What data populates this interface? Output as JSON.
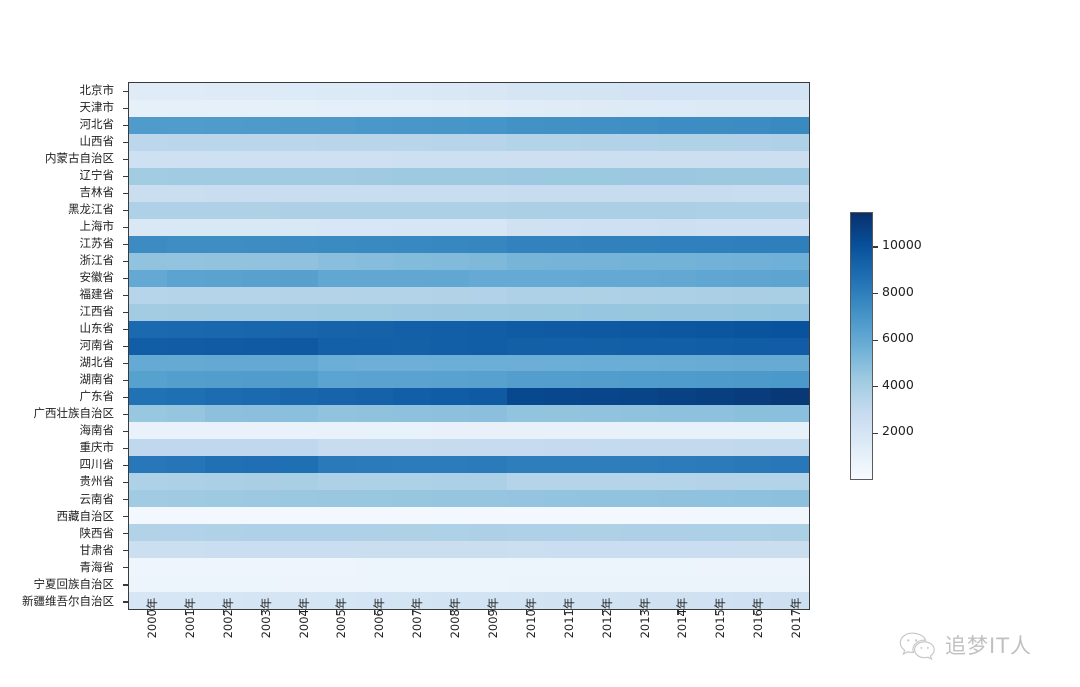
{
  "figure": {
    "type": "heatmap",
    "background": "#ffffff",
    "colormap": "Blues"
  },
  "watermark": {
    "label": "追梦IT人",
    "icon": "wechat-logo-icon"
  },
  "colorbar": {
    "position": "right",
    "vmin": 0,
    "vmax": 11500,
    "ticks": [
      2000,
      4000,
      6000,
      8000,
      10000
    ],
    "tick_labels": [
      "2000",
      "4000",
      "6000",
      "8000",
      "10000"
    ],
    "low_color": "#f7fbff",
    "high_color": "#08306b"
  },
  "chart_data": {
    "type": "heatmap",
    "title": "",
    "xlabel": "",
    "ylabel": "",
    "grid": false,
    "legend_position": "right",
    "colormap": "Blues",
    "vmin": 0,
    "vmax": 11500,
    "x": [
      "2000年",
      "2001年",
      "2002年",
      "2003年",
      "2004年",
      "2005年",
      "2006年",
      "2007年",
      "2008年",
      "2009年",
      "2010年",
      "2011年",
      "2012年",
      "2013年",
      "2014年",
      "2015年",
      "2016年",
      "2017年"
    ],
    "y": [
      "北京市",
      "天津市",
      "河北省",
      "山西省",
      "内蒙古自治区",
      "辽宁省",
      "吉林省",
      "黑龙江省",
      "上海市",
      "江苏省",
      "浙江省",
      "安徽省",
      "福建省",
      "江西省",
      "山东省",
      "河南省",
      "湖北省",
      "湖南省",
      "广东省",
      "广西壮族自治区",
      "海南省",
      "重庆市",
      "四川省",
      "贵州省",
      "云南省",
      "西藏自治区",
      "陕西省",
      "甘肃省",
      "青海省",
      "宁夏回族自治区",
      "新疆维吾尔自治区"
    ],
    "values": [
      [
        1364,
        1385,
        1423,
        1456,
        1493,
        1538,
        1581,
        1633,
        1695,
        1755,
        1962,
        2019,
        2069,
        2115,
        2152,
        2171,
        2173,
        2171
      ],
      [
        1001,
        1004,
        1007,
        1011,
        1024,
        1043,
        1075,
        1115,
        1176,
        1228,
        1299,
        1355,
        1413,
        1472,
        1517,
        1547,
        1562,
        1557
      ],
      [
        6744,
        6699,
        6735,
        6769,
        6809,
        6851,
        6898,
        6943,
        6989,
        7034,
        7194,
        7241,
        7288,
        7333,
        7384,
        7425,
        7470,
        7520
      ],
      [
        3247,
        3294,
        3294,
        3314,
        3335,
        3355,
        3375,
        3393,
        3411,
        3427,
        3574,
        3593,
        3611,
        3630,
        3648,
        3664,
        3682,
        3702
      ],
      [
        2376,
        2384,
        2379,
        2384,
        2393,
        2403,
        2415,
        2429,
        2444,
        2458,
        2472,
        2482,
        2490,
        2498,
        2505,
        2511,
        2520,
        2529
      ],
      [
        4184,
        4194,
        4203,
        4210,
        4217,
        4221,
        4271,
        4298,
        4315,
        4341,
        4375,
        4383,
        4389,
        4390,
        4391,
        4382,
        4378,
        4369
      ],
      [
        2628,
        2644,
        2653,
        2657,
        2662,
        2667,
        2723,
        2730,
        2734,
        2740,
        2747,
        2749,
        2750,
        2751,
        2752,
        2753,
        2733,
        2717
      ],
      [
        3689,
        3711,
        3732,
        3750,
        3770,
        3789,
        3823,
        3824,
        3826,
        3826,
        3833,
        3834,
        3834,
        3835,
        3835,
        3812,
        3799,
        3789
      ],
      [
        1674,
        1713,
        1713,
        1711,
        1742,
        1778,
        1815,
        1858,
        1888,
        1921,
        2303,
        2347,
        2380,
        2415,
        2426,
        2415,
        2420,
        2418
      ],
      [
        7438,
        7355,
        7381,
        7406,
        7433,
        7475,
        7550,
        7625,
        7677,
        7725,
        7869,
        7899,
        7920,
        7939,
        7960,
        7976,
        7999,
        8029
      ],
      [
        4680,
        4613,
        4647,
        4680,
        4719,
        4898,
        4980,
        5060,
        5120,
        5180,
        5447,
        5463,
        5477,
        5498,
        5508,
        5539,
        5590,
        5657
      ],
      [
        5986,
        6328,
        6338,
        6410,
        6461,
        6120,
        6110,
        6118,
        6135,
        5957,
        5957,
        5968,
        5988,
        6030,
        6083,
        6144,
        6196,
        6255
      ],
      [
        3410,
        3440,
        3466,
        3490,
        3511,
        3535,
        3558,
        3581,
        3604,
        3627,
        3693,
        3720,
        3748,
        3774,
        3806,
        3839,
        3874,
        3911
      ],
      [
        4140,
        4186,
        4222,
        4254,
        4284,
        4311,
        4339,
        4368,
        4400,
        4432,
        4462,
        4488,
        4504,
        4522,
        4542,
        4566,
        4592,
        4622
      ],
      [
        8997,
        9041,
        9082,
        9125,
        9163,
        9248,
        9309,
        9367,
        9417,
        9470,
        9588,
        9637,
        9685,
        9733,
        9789,
        9847,
        9947,
        10006
      ],
      [
        9488,
        9555,
        9613,
        9667,
        9717,
        9380,
        9392,
        9360,
        9429,
        9487,
        9405,
        9388,
        9406,
        9413,
        9436,
        9480,
        9532,
        9559
      ],
      [
        5960,
        5975,
        5988,
        6002,
        6016,
        5710,
        5693,
        5699,
        5711,
        5720,
        5728,
        5758,
        5779,
        5799,
        5816,
        5852,
        5885,
        5902
      ],
      [
        6440,
        6562,
        6629,
        6663,
        6698,
        6326,
        6342,
        6355,
        6380,
        6406,
        6570,
        6596,
        6639,
        6691,
        6737,
        6783,
        6822,
        6860
      ],
      [
        8642,
        8733,
        8842,
        8963,
        9111,
        9194,
        9304,
        9449,
        9544,
        9638,
        10441,
        10505,
        10594,
        10644,
        10724,
        10849,
        10999,
        11169
      ],
      [
        4489,
        4560,
        4822,
        4857,
        4889,
        4660,
        4719,
        4768,
        4816,
        4856,
        4610,
        4645,
        4682,
        4719,
        4754,
        4796,
        4838,
        4885
      ],
      [
        787,
        796,
        803,
        811,
        818,
        828,
        836,
        845,
        854,
        864,
        869,
        877,
        887,
        895,
        903,
        911,
        917,
        926
      ],
      [
        3090,
        3097,
        3107,
        3113,
        3122,
        2798,
        2808,
        2816,
        2839,
        2859,
        2885,
        2919,
        2945,
        2970,
        2991,
        3017,
        3048,
        3075
      ],
      [
        8329,
        8440,
        8673,
        8700,
        8724,
        8212,
        8169,
        8127,
        8138,
        8185,
        8042,
        8050,
        8076,
        8107,
        8140,
        8204,
        8262,
        8302
      ],
      [
        3756,
        3798,
        3837,
        3870,
        3904,
        3730,
        3757,
        3762,
        3793,
        3798,
        3479,
        3469,
        3484,
        3502,
        3508,
        3530,
        3555,
        3580
      ],
      [
        4241,
        4287,
        4333,
        4376,
        4415,
        4450,
        4483,
        4514,
        4543,
        4571,
        4602,
        4631,
        4659,
        4687,
        4714,
        4742,
        4771,
        4801
      ],
      [
        258,
        262,
        267,
        270,
        274,
        277,
        281,
        284,
        287,
        290,
        300,
        303,
        308,
        312,
        318,
        324,
        331,
        337
      ],
      [
        3605,
        3644,
        3674,
        3690,
        3705,
        3720,
        3735,
        3748,
        3762,
        3772,
        3735,
        3743,
        3753,
        3764,
        3775,
        3793,
        3813,
        3835
      ],
      [
        2515,
        2543,
        2562,
        2575,
        2593,
        2594,
        2606,
        2617,
        2628,
        2635,
        2557,
        2564,
        2578,
        2582,
        2591,
        2600,
        2610,
        2626
      ],
      [
        510,
        517,
        523,
        529,
        534,
        543,
        548,
        552,
        554,
        557,
        563,
        568,
        573,
        578,
        583,
        588,
        593,
        598
      ],
      [
        554,
        563,
        572,
        580,
        588,
        596,
        604,
        610,
        616,
        625,
        633,
        639,
        647,
        654,
        662,
        668,
        675,
        682
      ],
      [
        1849,
        1876,
        1905,
        1934,
        1963,
        2010,
        2050,
        2095,
        2131,
        2159,
        2185,
        2209,
        2233,
        2264,
        2298,
        2360,
        2398,
        2445
      ]
    ]
  }
}
